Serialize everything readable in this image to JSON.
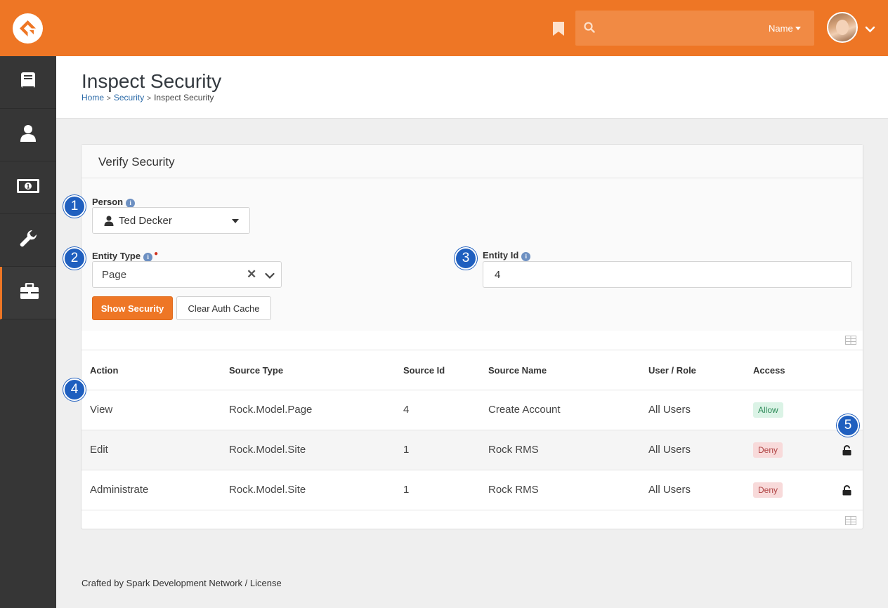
{
  "header": {
    "search_placeholder": "",
    "search_filter_label": "Name",
    "bookmark_icon": "bookmark-icon",
    "logo_icon": "rock-logo-icon"
  },
  "sidebar": {
    "items": [
      {
        "icon": "book-icon"
      },
      {
        "icon": "person-icon"
      },
      {
        "icon": "money-icon"
      },
      {
        "icon": "wrench-icon"
      },
      {
        "icon": "briefcase-icon",
        "active": true
      }
    ]
  },
  "page": {
    "title": "Inspect Security",
    "breadcrumb": [
      "Home",
      "Security",
      "Inspect Security"
    ]
  },
  "panel": {
    "title": "Verify Security",
    "person_label": "Person",
    "person_value": "Ted Decker",
    "entity_type_label": "Entity Type",
    "entity_type_value": "Page",
    "entity_id_label": "Entity Id",
    "entity_id_value": "4",
    "show_security_button": "Show Security",
    "clear_auth_cache_button": "Clear Auth Cache"
  },
  "table": {
    "columns": [
      "Action",
      "Source Type",
      "Source Id",
      "Source Name",
      "User / Role",
      "Access"
    ],
    "rows": [
      {
        "action": "View",
        "source_type": "Rock.Model.Page",
        "source_id": "4",
        "source_name": "Create Account",
        "user_role": "All Users",
        "access": "Allow",
        "lock": false
      },
      {
        "action": "Edit",
        "source_type": "Rock.Model.Site",
        "source_id": "1",
        "source_name": "Rock RMS",
        "user_role": "All Users",
        "access": "Deny",
        "lock": true
      },
      {
        "action": "Administrate",
        "source_type": "Rock.Model.Site",
        "source_id": "1",
        "source_name": "Rock RMS",
        "user_role": "All Users",
        "access": "Deny",
        "lock": true
      }
    ]
  },
  "callouts": [
    "1",
    "2",
    "3",
    "4",
    "5"
  ],
  "footer": {
    "text": "Crafted by Spark Development Network / License"
  },
  "colors": {
    "brand": "#ee7625",
    "sidebar": "#363636",
    "callout": "#1f5fbf",
    "link": "#2b6aa8"
  }
}
